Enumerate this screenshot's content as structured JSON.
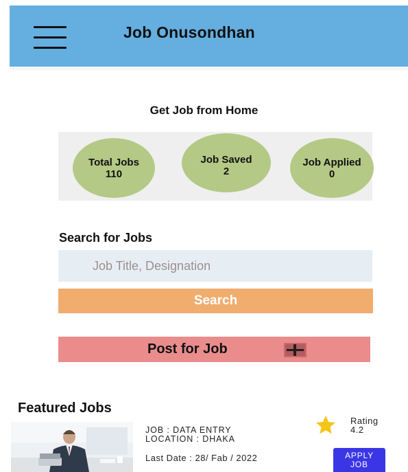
{
  "app": {
    "title": "Job Onusondhan"
  },
  "hero": {
    "subtitle": "Get Job from Home"
  },
  "stats": [
    {
      "label": "Total Jobs",
      "value": "110"
    },
    {
      "label": "Job Saved",
      "value": "2"
    },
    {
      "label": "Job Applied",
      "value": "0"
    }
  ],
  "search": {
    "section_label": "Search for Jobs",
    "placeholder": "Job Title, Designation",
    "value": "",
    "button_label": "Search"
  },
  "post": {
    "button_label": "Post for Job"
  },
  "featured": {
    "title": "Featured Jobs",
    "jobs": [
      {
        "job_line": "JOB : DATA ENTRY",
        "location_line": "LOCATION : DHAKA",
        "last_date": "Last Date : 28/ Fab / 2022",
        "rating_label": "Rating",
        "rating_value": "4.2",
        "apply_label_1": "APPLY",
        "apply_label_2": "JOB"
      }
    ]
  },
  "colors": {
    "appbar": "#64aee0",
    "stat_circle": "#b4c985",
    "search_button": "#f0ad6e",
    "post_button": "#ea8c8c",
    "apply_button": "#3a36e6",
    "star": "#f5c518"
  },
  "icons": [
    "menu-icon",
    "plus-icon",
    "star-icon"
  ]
}
